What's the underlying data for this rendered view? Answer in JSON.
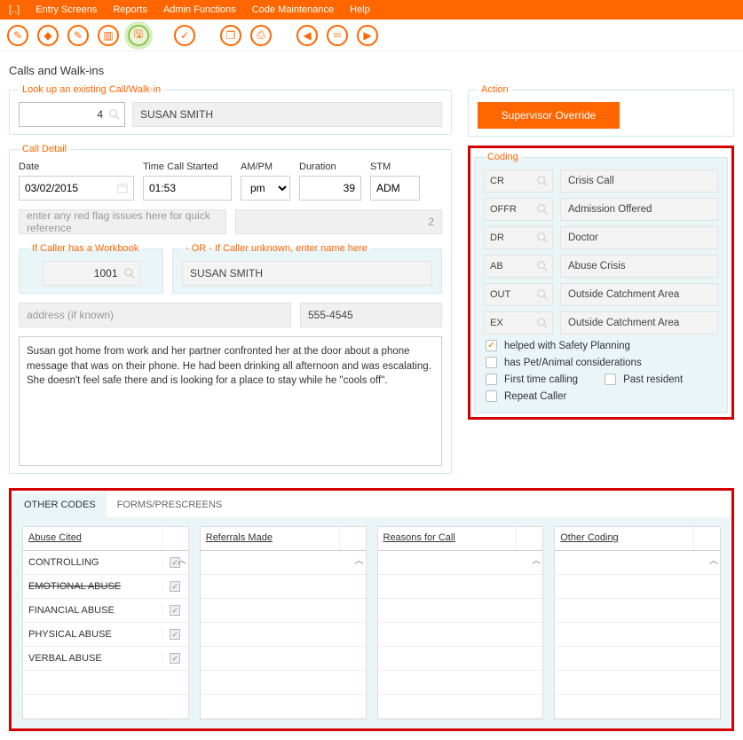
{
  "menu": {
    "items": [
      "[..]",
      "Entry Screens",
      "Reports",
      "Admin Functions",
      "Code Maintenance",
      "Help"
    ]
  },
  "page_title": "Calls and Walk-ins",
  "lookup": {
    "legend": "Look up an existing Call/Walk-in",
    "id_value": "4",
    "name": "SUSAN SMITH"
  },
  "action": {
    "legend": "Action",
    "button": "Supervisor Override"
  },
  "call_detail": {
    "legend": "Call Detail",
    "labels": {
      "date": "Date",
      "time": "Time Call Started",
      "ampm": "AM/PM",
      "duration": "Duration",
      "stm": "STM"
    },
    "date": "03/02/2015",
    "time": "01:53",
    "ampm": "pm",
    "duration": "39",
    "stm": "ADM",
    "redflag_placeholder": "enter any red flag issues here for quick reference",
    "redflag_count": "2",
    "workbook": {
      "legend": "If Caller has a Workbook",
      "value": "1001"
    },
    "unknown": {
      "legend": "- OR - If Caller unknown, enter name here",
      "value": "SUSAN SMITH"
    },
    "address_placeholder": "address (if known)",
    "phone": "555-4545",
    "notes": "Susan got home from work and her partner confronted her at the door about a phone message that was on their phone.  He had been drinking all afternoon and was escalating.  She doesn't feel safe there and is looking for a place to stay while he \"cools off\"."
  },
  "coding": {
    "legend": "Coding",
    "rows": [
      {
        "code": "CR",
        "text": "Crisis Call"
      },
      {
        "code": "OFFR",
        "text": "Admission Offered"
      },
      {
        "code": "DR",
        "text": "Doctor"
      },
      {
        "code": "AB",
        "text": "Abuse Crisis"
      },
      {
        "code": "OUT",
        "text": "Outside Catchment Area"
      },
      {
        "code": "EX",
        "text": "Outside Catchment Area"
      }
    ],
    "checks": [
      {
        "label": "helped with Safety Planning",
        "on": true
      },
      {
        "label": "has Pet/Animal considerations",
        "on": false
      },
      {
        "label": "First time calling",
        "on": false,
        "inline_with_next": true
      },
      {
        "label": "Past resident",
        "on": false
      },
      {
        "label": "Repeat Caller",
        "on": false
      }
    ]
  },
  "tabs": {
    "items": [
      "OTHER CODES",
      "FORMS/PRESCREENS"
    ],
    "active": 0
  },
  "columns": [
    {
      "header": "Abuse Cited",
      "rows": [
        {
          "label": "CONTROLLING",
          "checked": true,
          "strike": false
        },
        {
          "label": "EMOTIONAL ABUSE",
          "checked": true,
          "strike": true
        },
        {
          "label": "FINANCIAL ABUSE",
          "checked": true,
          "strike": false
        },
        {
          "label": "PHYSICAL ABUSE",
          "checked": true,
          "strike": false
        },
        {
          "label": "VERBAL ABUSE",
          "checked": true,
          "strike": false
        },
        {
          "label": "",
          "checked": false,
          "strike": false
        },
        {
          "label": "",
          "checked": false,
          "strike": false
        }
      ]
    },
    {
      "header": "Referrals Made",
      "rows": [
        {
          "label": ""
        },
        {
          "label": ""
        },
        {
          "label": ""
        },
        {
          "label": ""
        },
        {
          "label": ""
        },
        {
          "label": ""
        },
        {
          "label": ""
        }
      ]
    },
    {
      "header": "Reasons for Call",
      "rows": [
        {
          "label": ""
        },
        {
          "label": ""
        },
        {
          "label": ""
        },
        {
          "label": ""
        },
        {
          "label": ""
        },
        {
          "label": ""
        },
        {
          "label": ""
        }
      ]
    },
    {
      "header": "Other Coding",
      "rows": [
        {
          "label": ""
        },
        {
          "label": ""
        },
        {
          "label": ""
        },
        {
          "label": ""
        },
        {
          "label": ""
        },
        {
          "label": ""
        },
        {
          "label": ""
        }
      ]
    }
  ]
}
